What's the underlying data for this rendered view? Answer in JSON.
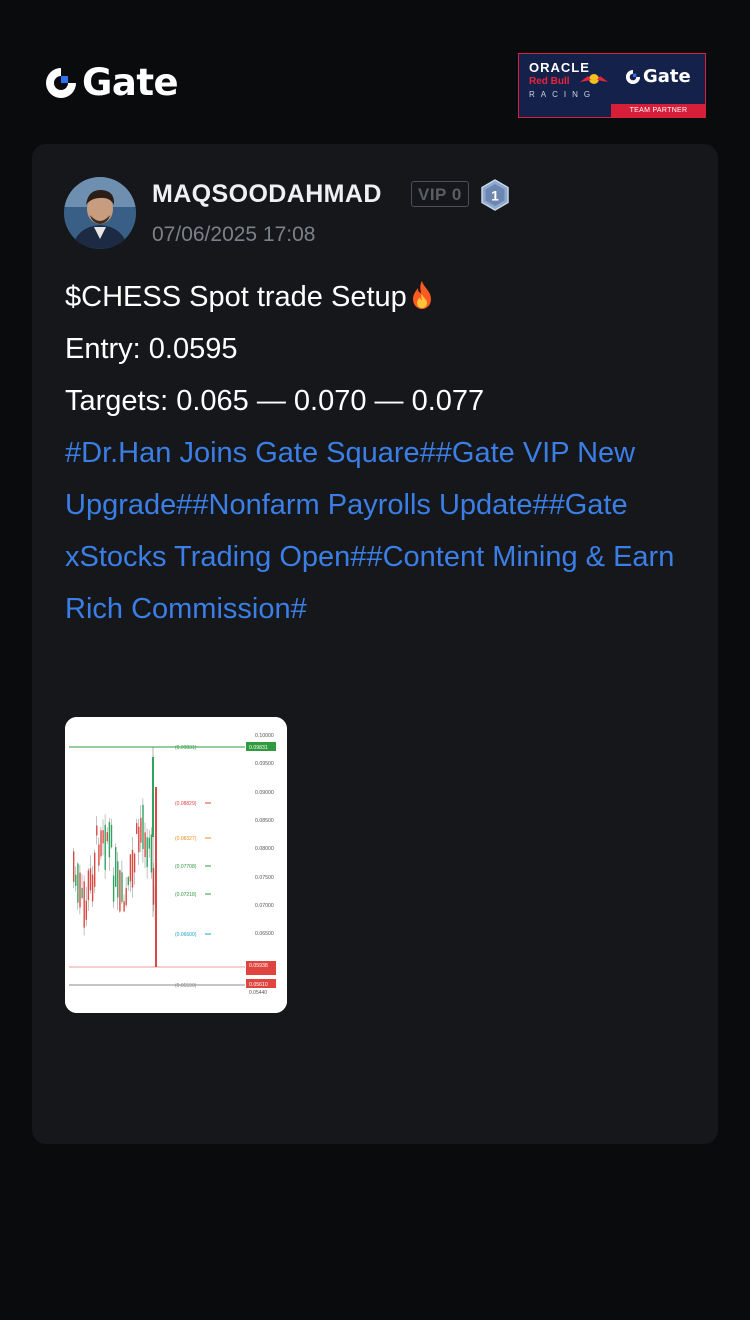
{
  "brand": {
    "name": "Gate",
    "accent": "#2f6ff5"
  },
  "partner": {
    "oracle": "ORACLE",
    "redbull": "Red Bull",
    "racing": "RACING",
    "gate": "Gate",
    "team": "TEAM PARTNER"
  },
  "post": {
    "author": "MAQSOODAHMAD",
    "vip": "VIP 0",
    "level": "1",
    "date": "07/06/2025 17:08",
    "title": "$CHESS Spot trade Setup",
    "entry": "Entry: 0.0595",
    "targets": "Targets: 0.065 — 0.070 — 0.077",
    "tags": "#Dr.Han Joins Gate Square##Gate VIP New Upgrade##Nonfarm Payrolls Update##Gate xStocks Trading Open##Content Mining & Earn Rich Commission#",
    "tag_color": "#3a7ee6"
  },
  "chart_thumb": {
    "price_ticks": [
      "0.10000",
      "0.09500",
      "0.09000",
      "0.08500",
      "0.08000",
      "0.07500",
      "0.07000",
      "0.06500"
    ],
    "top_tag": "0.09831",
    "bottom_tags": [
      "0.05938",
      "0.05610"
    ],
    "bottom_small": "0.05440",
    "levels": [
      {
        "label": "(0.09831)",
        "color": "#2f9a3e"
      },
      {
        "label": "(0.08829)",
        "color": "#e0443e"
      },
      {
        "label": "(0.08327)",
        "color": "#f08a24"
      },
      {
        "label": "(0.07708)",
        "color": "#2f9a3e"
      },
      {
        "label": "(0.07218)",
        "color": "#2f9a3e"
      },
      {
        "label": "(0.06600)",
        "color": "#18a6c9"
      },
      {
        "label": "(0.05590)",
        "color": "#888888"
      }
    ]
  }
}
